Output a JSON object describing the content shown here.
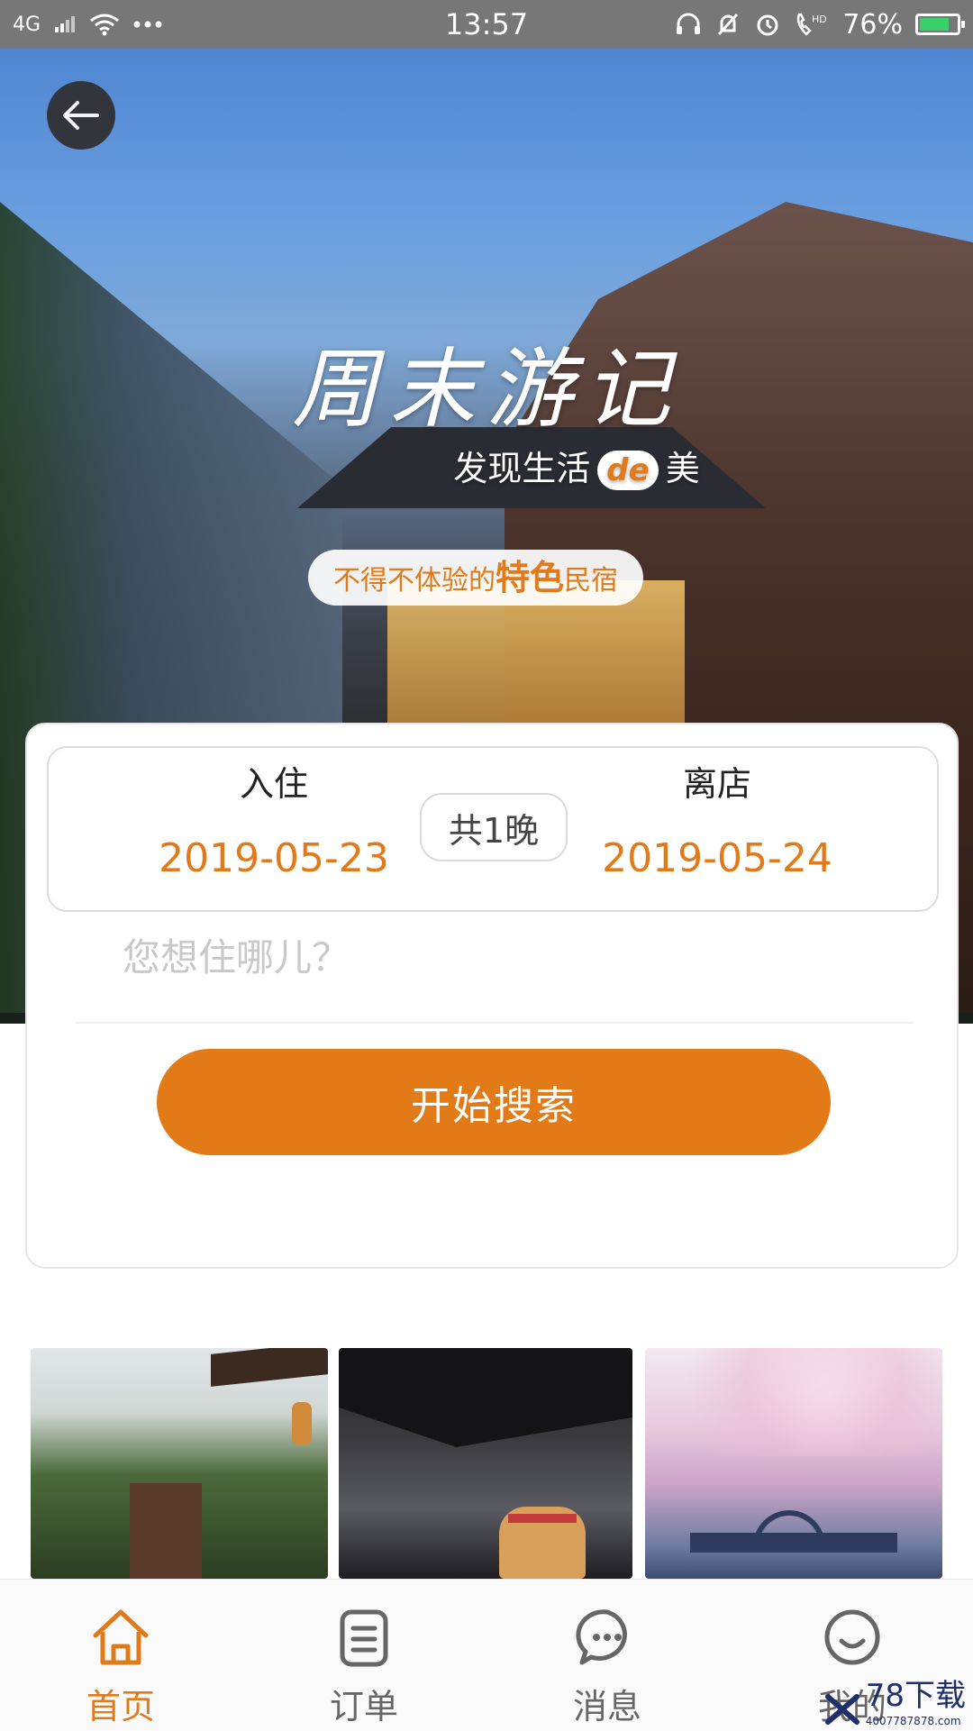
{
  "status_bar": {
    "network": "4G",
    "time": "13:57",
    "battery_percent": "76%"
  },
  "hero": {
    "title": "周末游记",
    "subtitle_left": "发现生活",
    "subtitle_badge": "de",
    "subtitle_right": "美",
    "pill_prefix": "不得不体验的",
    "pill_highlight": "特色",
    "pill_suffix": "民宿"
  },
  "booking": {
    "checkin_label": "入住",
    "checkin_date": "2019-05-23",
    "nights_label": "共1晚",
    "checkout_label": "离店",
    "checkout_date": "2019-05-24",
    "destination_placeholder": "您想住哪儿？",
    "search_button": "开始搜索"
  },
  "bottom_nav": {
    "items": [
      {
        "label": "首页",
        "icon": "home-icon",
        "active": true
      },
      {
        "label": "订单",
        "icon": "order-icon",
        "active": false
      },
      {
        "label": "消息",
        "icon": "message-icon",
        "active": false
      },
      {
        "label": "我的",
        "icon": "profile-icon",
        "active": false
      }
    ]
  },
  "watermark": {
    "brand": "78下载",
    "phone": "4007787878.com"
  },
  "colors": {
    "accent": "#e27a17",
    "text_dark": "#222222",
    "placeholder": "#c8c8c8"
  }
}
